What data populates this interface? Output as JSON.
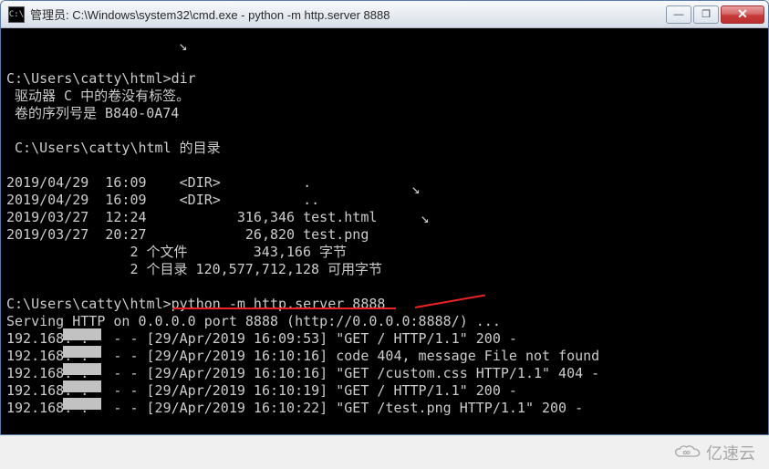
{
  "window": {
    "title": "管理员: C:\\Windows\\system32\\cmd.exe - python  -m http.server 8888",
    "icon_name": "cmd-icon",
    "buttons": {
      "minimize": "—",
      "maximize": "❐",
      "close": "✕"
    }
  },
  "terminal": {
    "prompt1": "C:\\Users\\catty\\html>",
    "command1": "dir",
    "line_drive": " 驱动器 C 中的卷没有标签。",
    "line_serial": " 卷的序列号是 B840-0A74",
    "line_dirof": " C:\\Users\\catty\\html 的目录",
    "dir_entries": [
      "2019/04/29  16:09    <DIR>          .",
      "2019/04/29  16:09    <DIR>          ..",
      "2019/03/27  12:24           316,346 test.html",
      "2019/03/27  20:27            26,820 test.png",
      "               2 个文件        343,166 字节",
      "               2 个目录 120,577,712,128 可用字节"
    ],
    "prompt2": "C:\\Users\\catty\\html>",
    "command2": "python -m http.server 8888",
    "serving_line": "Serving HTTP on 0.0.0.0 port 8888 (http://0.0.0.0:8888/) ...",
    "log_lines": [
      "192.168. .   - - [29/Apr/2019 16:09:53] \"GET / HTTP/1.1\" 200 -",
      "192.168. .   - - [29/Apr/2019 16:10:16] code 404, message File not found",
      "192.168. .   - - [29/Apr/2019 16:10:16] \"GET /custom.css HTTP/1.1\" 404 -",
      "192.168. .   - - [29/Apr/2019 16:10:19] \"GET / HTTP/1.1\" 200 -",
      "192.168. .   - - [29/Apr/2019 16:10:22] \"GET /test.png HTTP/1.1\" 200 -"
    ]
  },
  "annotations": {
    "arrow_glyph": "↘"
  },
  "watermark": {
    "text": "亿速云"
  }
}
